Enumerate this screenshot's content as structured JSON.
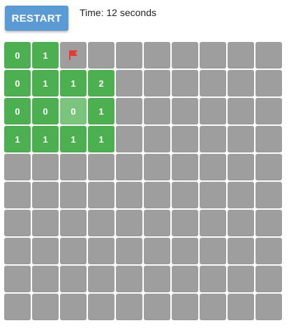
{
  "header": {
    "restart_label": "RESTART",
    "timer_text": "Time: 12 seconds"
  },
  "colors": {
    "hidden": "#9e9e9e",
    "revealed": "#4caf50",
    "highlight": "#7bc47e",
    "restart_button": "#5b9bd5",
    "flag": "#e53935"
  },
  "board": {
    "rows": [
      [
        {
          "s": "r",
          "v": "0"
        },
        {
          "s": "r",
          "v": "1"
        },
        {
          "s": "f"
        },
        {
          "s": "h"
        },
        {
          "s": "h"
        },
        {
          "s": "h"
        },
        {
          "s": "h"
        },
        {
          "s": "h"
        },
        {
          "s": "h"
        },
        {
          "s": "h"
        }
      ],
      [
        {
          "s": "r",
          "v": "0"
        },
        {
          "s": "r",
          "v": "1"
        },
        {
          "s": "r",
          "v": "1"
        },
        {
          "s": "r",
          "v": "2"
        },
        {
          "s": "h"
        },
        {
          "s": "h"
        },
        {
          "s": "h"
        },
        {
          "s": "h"
        },
        {
          "s": "h"
        },
        {
          "s": "h"
        }
      ],
      [
        {
          "s": "r",
          "v": "0"
        },
        {
          "s": "r",
          "v": "0"
        },
        {
          "s": "x",
          "v": "0"
        },
        {
          "s": "r",
          "v": "1"
        },
        {
          "s": "h"
        },
        {
          "s": "h"
        },
        {
          "s": "h"
        },
        {
          "s": "h"
        },
        {
          "s": "h"
        },
        {
          "s": "h"
        }
      ],
      [
        {
          "s": "r",
          "v": "1"
        },
        {
          "s": "r",
          "v": "1"
        },
        {
          "s": "r",
          "v": "1"
        },
        {
          "s": "r",
          "v": "1"
        },
        {
          "s": "h"
        },
        {
          "s": "h"
        },
        {
          "s": "h"
        },
        {
          "s": "h"
        },
        {
          "s": "h"
        },
        {
          "s": "h"
        }
      ],
      [
        {
          "s": "h"
        },
        {
          "s": "h"
        },
        {
          "s": "h"
        },
        {
          "s": "h"
        },
        {
          "s": "h"
        },
        {
          "s": "h"
        },
        {
          "s": "h"
        },
        {
          "s": "h"
        },
        {
          "s": "h"
        },
        {
          "s": "h"
        }
      ],
      [
        {
          "s": "h"
        },
        {
          "s": "h"
        },
        {
          "s": "h"
        },
        {
          "s": "h"
        },
        {
          "s": "h"
        },
        {
          "s": "h"
        },
        {
          "s": "h"
        },
        {
          "s": "h"
        },
        {
          "s": "h"
        },
        {
          "s": "h"
        }
      ],
      [
        {
          "s": "h"
        },
        {
          "s": "h"
        },
        {
          "s": "h"
        },
        {
          "s": "h"
        },
        {
          "s": "h"
        },
        {
          "s": "h"
        },
        {
          "s": "h"
        },
        {
          "s": "h"
        },
        {
          "s": "h"
        },
        {
          "s": "h"
        }
      ],
      [
        {
          "s": "h"
        },
        {
          "s": "h"
        },
        {
          "s": "h"
        },
        {
          "s": "h"
        },
        {
          "s": "h"
        },
        {
          "s": "h"
        },
        {
          "s": "h"
        },
        {
          "s": "h"
        },
        {
          "s": "h"
        },
        {
          "s": "h"
        }
      ],
      [
        {
          "s": "h"
        },
        {
          "s": "h"
        },
        {
          "s": "h"
        },
        {
          "s": "h"
        },
        {
          "s": "h"
        },
        {
          "s": "h"
        },
        {
          "s": "h"
        },
        {
          "s": "h"
        },
        {
          "s": "h"
        },
        {
          "s": "h"
        }
      ],
      [
        {
          "s": "h"
        },
        {
          "s": "h"
        },
        {
          "s": "h"
        },
        {
          "s": "h"
        },
        {
          "s": "h"
        },
        {
          "s": "h"
        },
        {
          "s": "h"
        },
        {
          "s": "h"
        },
        {
          "s": "h"
        },
        {
          "s": "h"
        }
      ]
    ]
  }
}
